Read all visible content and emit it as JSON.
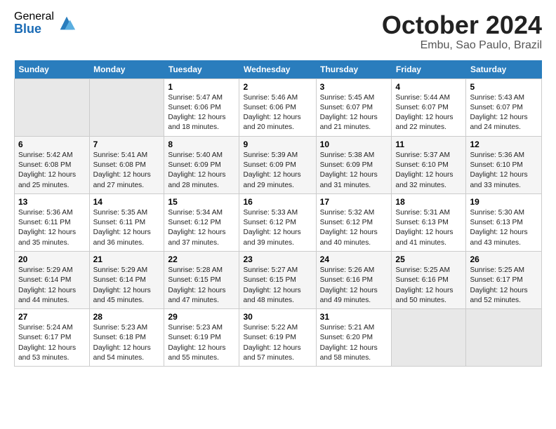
{
  "logo": {
    "general": "General",
    "blue": "Blue"
  },
  "header": {
    "month": "October 2024",
    "location": "Embu, Sao Paulo, Brazil"
  },
  "weekdays": [
    "Sunday",
    "Monday",
    "Tuesday",
    "Wednesday",
    "Thursday",
    "Friday",
    "Saturday"
  ],
  "weeks": [
    [
      {
        "day": "",
        "info": ""
      },
      {
        "day": "",
        "info": ""
      },
      {
        "day": "1",
        "info": "Sunrise: 5:47 AM\nSunset: 6:06 PM\nDaylight: 12 hours and 18 minutes."
      },
      {
        "day": "2",
        "info": "Sunrise: 5:46 AM\nSunset: 6:06 PM\nDaylight: 12 hours and 20 minutes."
      },
      {
        "day": "3",
        "info": "Sunrise: 5:45 AM\nSunset: 6:07 PM\nDaylight: 12 hours and 21 minutes."
      },
      {
        "day": "4",
        "info": "Sunrise: 5:44 AM\nSunset: 6:07 PM\nDaylight: 12 hours and 22 minutes."
      },
      {
        "day": "5",
        "info": "Sunrise: 5:43 AM\nSunset: 6:07 PM\nDaylight: 12 hours and 24 minutes."
      }
    ],
    [
      {
        "day": "6",
        "info": "Sunrise: 5:42 AM\nSunset: 6:08 PM\nDaylight: 12 hours and 25 minutes."
      },
      {
        "day": "7",
        "info": "Sunrise: 5:41 AM\nSunset: 6:08 PM\nDaylight: 12 hours and 27 minutes."
      },
      {
        "day": "8",
        "info": "Sunrise: 5:40 AM\nSunset: 6:09 PM\nDaylight: 12 hours and 28 minutes."
      },
      {
        "day": "9",
        "info": "Sunrise: 5:39 AM\nSunset: 6:09 PM\nDaylight: 12 hours and 29 minutes."
      },
      {
        "day": "10",
        "info": "Sunrise: 5:38 AM\nSunset: 6:09 PM\nDaylight: 12 hours and 31 minutes."
      },
      {
        "day": "11",
        "info": "Sunrise: 5:37 AM\nSunset: 6:10 PM\nDaylight: 12 hours and 32 minutes."
      },
      {
        "day": "12",
        "info": "Sunrise: 5:36 AM\nSunset: 6:10 PM\nDaylight: 12 hours and 33 minutes."
      }
    ],
    [
      {
        "day": "13",
        "info": "Sunrise: 5:36 AM\nSunset: 6:11 PM\nDaylight: 12 hours and 35 minutes."
      },
      {
        "day": "14",
        "info": "Sunrise: 5:35 AM\nSunset: 6:11 PM\nDaylight: 12 hours and 36 minutes."
      },
      {
        "day": "15",
        "info": "Sunrise: 5:34 AM\nSunset: 6:12 PM\nDaylight: 12 hours and 37 minutes."
      },
      {
        "day": "16",
        "info": "Sunrise: 5:33 AM\nSunset: 6:12 PM\nDaylight: 12 hours and 39 minutes."
      },
      {
        "day": "17",
        "info": "Sunrise: 5:32 AM\nSunset: 6:12 PM\nDaylight: 12 hours and 40 minutes."
      },
      {
        "day": "18",
        "info": "Sunrise: 5:31 AM\nSunset: 6:13 PM\nDaylight: 12 hours and 41 minutes."
      },
      {
        "day": "19",
        "info": "Sunrise: 5:30 AM\nSunset: 6:13 PM\nDaylight: 12 hours and 43 minutes."
      }
    ],
    [
      {
        "day": "20",
        "info": "Sunrise: 5:29 AM\nSunset: 6:14 PM\nDaylight: 12 hours and 44 minutes."
      },
      {
        "day": "21",
        "info": "Sunrise: 5:29 AM\nSunset: 6:14 PM\nDaylight: 12 hours and 45 minutes."
      },
      {
        "day": "22",
        "info": "Sunrise: 5:28 AM\nSunset: 6:15 PM\nDaylight: 12 hours and 47 minutes."
      },
      {
        "day": "23",
        "info": "Sunrise: 5:27 AM\nSunset: 6:15 PM\nDaylight: 12 hours and 48 minutes."
      },
      {
        "day": "24",
        "info": "Sunrise: 5:26 AM\nSunset: 6:16 PM\nDaylight: 12 hours and 49 minutes."
      },
      {
        "day": "25",
        "info": "Sunrise: 5:25 AM\nSunset: 6:16 PM\nDaylight: 12 hours and 50 minutes."
      },
      {
        "day": "26",
        "info": "Sunrise: 5:25 AM\nSunset: 6:17 PM\nDaylight: 12 hours and 52 minutes."
      }
    ],
    [
      {
        "day": "27",
        "info": "Sunrise: 5:24 AM\nSunset: 6:17 PM\nDaylight: 12 hours and 53 minutes."
      },
      {
        "day": "28",
        "info": "Sunrise: 5:23 AM\nSunset: 6:18 PM\nDaylight: 12 hours and 54 minutes."
      },
      {
        "day": "29",
        "info": "Sunrise: 5:23 AM\nSunset: 6:19 PM\nDaylight: 12 hours and 55 minutes."
      },
      {
        "day": "30",
        "info": "Sunrise: 5:22 AM\nSunset: 6:19 PM\nDaylight: 12 hours and 57 minutes."
      },
      {
        "day": "31",
        "info": "Sunrise: 5:21 AM\nSunset: 6:20 PM\nDaylight: 12 hours and 58 minutes."
      },
      {
        "day": "",
        "info": ""
      },
      {
        "day": "",
        "info": ""
      }
    ]
  ]
}
